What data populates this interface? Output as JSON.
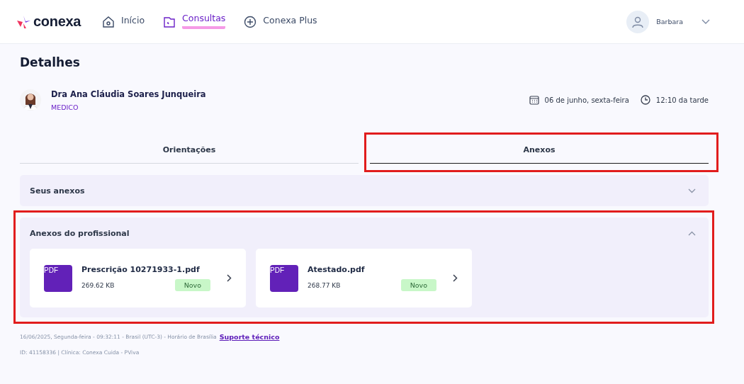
{
  "header": {
    "brand": "conexa",
    "nav": [
      {
        "label": "Início",
        "selected": false
      },
      {
        "label": "Consultas",
        "selected": true
      },
      {
        "label": "Conexa Plus",
        "selected": false
      }
    ],
    "user": {
      "name": "Barbara"
    }
  },
  "title": "Detalhes",
  "doctor": {
    "name": "Dra Ana Cláudia Soares Junqueira",
    "role": "MEDICO",
    "date": "06 de junho, sexta-feira",
    "time": "12:10 da tarde"
  },
  "tabs": [
    {
      "label": "Orientações",
      "selected": false,
      "highlighted": false
    },
    {
      "label": "Anexos",
      "selected": true,
      "highlighted": true
    }
  ],
  "sections": [
    {
      "title": "Seus anexos",
      "expanded": false,
      "highlighted": false
    },
    {
      "title": "Anexos do profissional",
      "expanded": true,
      "highlighted": true,
      "files": [
        {
          "type": "PDF",
          "name": "Prescrição 10271933-1.pdf",
          "size": "269.62 KB",
          "badge": "Novo"
        },
        {
          "type": "PDF",
          "name": "Atestado.pdf",
          "size": "268.77 KB",
          "badge": "Novo"
        }
      ]
    }
  ],
  "footer": {
    "info": "16/06/2025, Segunda-feira - 09:32:11 - Brasil (UTC-3) - Horário de Brasília",
    "link": "Suporte técnico",
    "id_line": "ID: 41158336 | Clínica: Conexa Cuida - PViva"
  }
}
